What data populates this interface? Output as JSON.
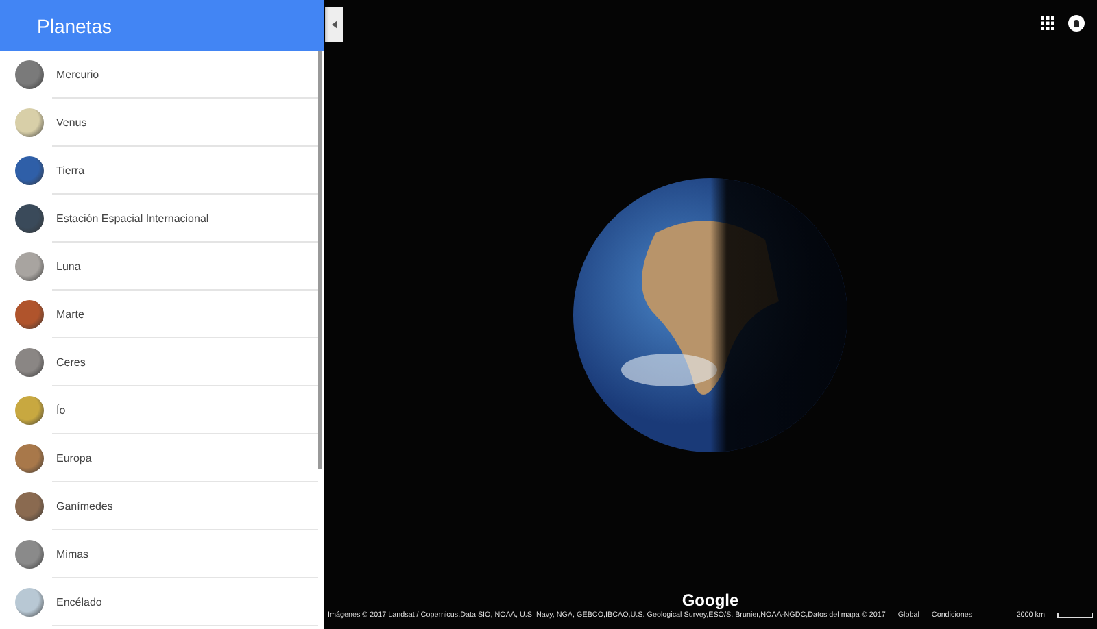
{
  "sidebar": {
    "title": "Planetas",
    "items": [
      {
        "label": "Mercurio",
        "color": "#7a7a7a"
      },
      {
        "label": "Venus",
        "color": "#d8cfa8"
      },
      {
        "label": "Tierra",
        "color": "#2f5fa8"
      },
      {
        "label": "Estación Espacial Internacional",
        "color": "#3a4a5a"
      },
      {
        "label": "Luna",
        "color": "#a8a4a0"
      },
      {
        "label": "Marte",
        "color": "#b0542c"
      },
      {
        "label": "Ceres",
        "color": "#8a8684"
      },
      {
        "label": "Ío",
        "color": "#c8a840"
      },
      {
        "label": "Europa",
        "color": "#a8784a"
      },
      {
        "label": "Ganímedes",
        "color": "#8a6a50"
      },
      {
        "label": "Mimas",
        "color": "#8a8a8a"
      },
      {
        "label": "Encélado",
        "color": "#b8c8d4"
      }
    ]
  },
  "map": {
    "logo": "Google",
    "attribution": "Imágenes © 2017 Landsat / Copernicus,Data SIO, NOAA, U.S. Navy, NGA, GEBCO,IBCAO,U.S. Geological Survey,ESO/S. Brunier,NOAA-NGDC,Datos del mapa © 2017",
    "links": [
      "Global",
      "Condiciones"
    ],
    "scale": "2000 km"
  }
}
